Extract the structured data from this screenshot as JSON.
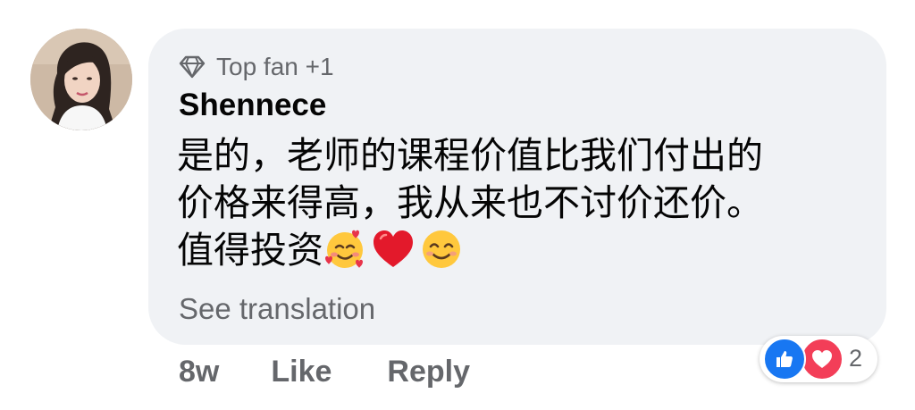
{
  "comment": {
    "badge": "Top fan +1",
    "author": "Shennece",
    "lines": [
      "是的，老师的课程价值比我们付出的",
      "价格来得高，我从来也不讨价还价。",
      "值得投资"
    ],
    "emojis": [
      "smiling-face-with-hearts",
      "red-heart",
      "smiling-face-with-smiling-eyes"
    ],
    "see_translation": "See translation",
    "time": "8w",
    "like_label": "Like",
    "reply_label": "Reply",
    "reaction_count": "2",
    "reactions": [
      "like",
      "love"
    ]
  },
  "colors": {
    "bubble": "#f0f2f5",
    "secondary_text": "#65676b",
    "like_blue": "#1877f2",
    "love_red": "#f33e58"
  }
}
